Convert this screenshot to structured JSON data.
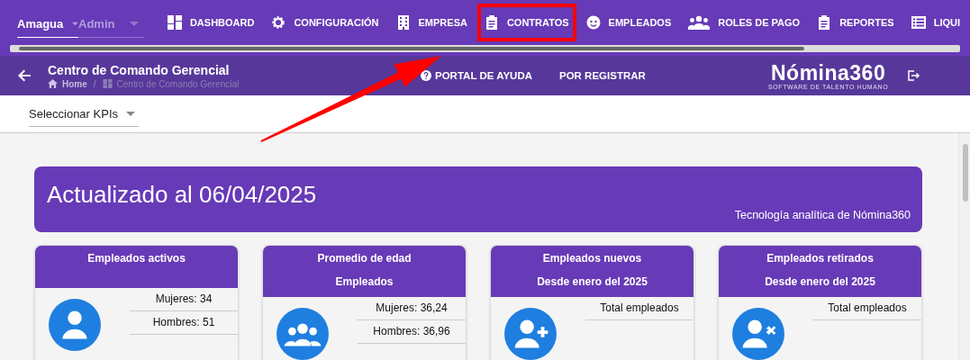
{
  "top_bar": {
    "company": "Amagua",
    "role": "Admin",
    "nav": [
      {
        "label": "DASHBOARD",
        "kind": "dashboard",
        "highlighted": false
      },
      {
        "label": "CONFIGURACIÓN",
        "kind": "settings",
        "highlighted": false
      },
      {
        "label": "EMPRESA",
        "kind": "company",
        "highlighted": false
      },
      {
        "label": "CONTRATOS",
        "kind": "contracts",
        "highlighted": true
      },
      {
        "label": "EMPLEADOS",
        "kind": "employees",
        "highlighted": false
      },
      {
        "label": "ROLES DE PAGO",
        "kind": "payroll",
        "highlighted": false
      },
      {
        "label": "REPORTES",
        "kind": "contracts",
        "highlighted": false
      },
      {
        "label": "LIQUI",
        "kind": "settlement",
        "highlighted": false
      }
    ]
  },
  "header": {
    "title": "Centro de Comando Gerencial",
    "breadcrumb": [
      "Home",
      "/",
      "Centro de Comando Gerencial"
    ],
    "links": [
      {
        "label": "PORTAL DE AYUDA",
        "kind": "help"
      },
      {
        "label": "POR REGISTRAR",
        "kind": "plain"
      }
    ],
    "logo": {
      "name": "Nómina360",
      "tagline": "SOFTWARE DE TALENTO HUMANO"
    }
  },
  "kpi_select": {
    "placeholder": "Seleccionar KPIs"
  },
  "banner": {
    "title": "Actualizado al 06/04/2025",
    "caption": "Tecnología analítica de Nómina360"
  },
  "cards": [
    {
      "title": "Empleados activos",
      "kind": "active",
      "rows": [
        "Mujeres: 34",
        "Hombres: 51"
      ]
    },
    {
      "title": "Promedio de edad",
      "subtitle": "Empleados",
      "kind": "age",
      "rows": [
        "Mujeres: 36,24",
        "Hombres: 36,96"
      ]
    },
    {
      "title": "Empleados nuevos",
      "subtitle": "Desde enero del 2025",
      "kind": "new",
      "rows": [
        "Total empleados"
      ]
    },
    {
      "title": "Empleados retirados",
      "subtitle": "Desde enero del 2025",
      "kind": "retired",
      "rows": [
        "Total empleados"
      ]
    }
  ]
}
